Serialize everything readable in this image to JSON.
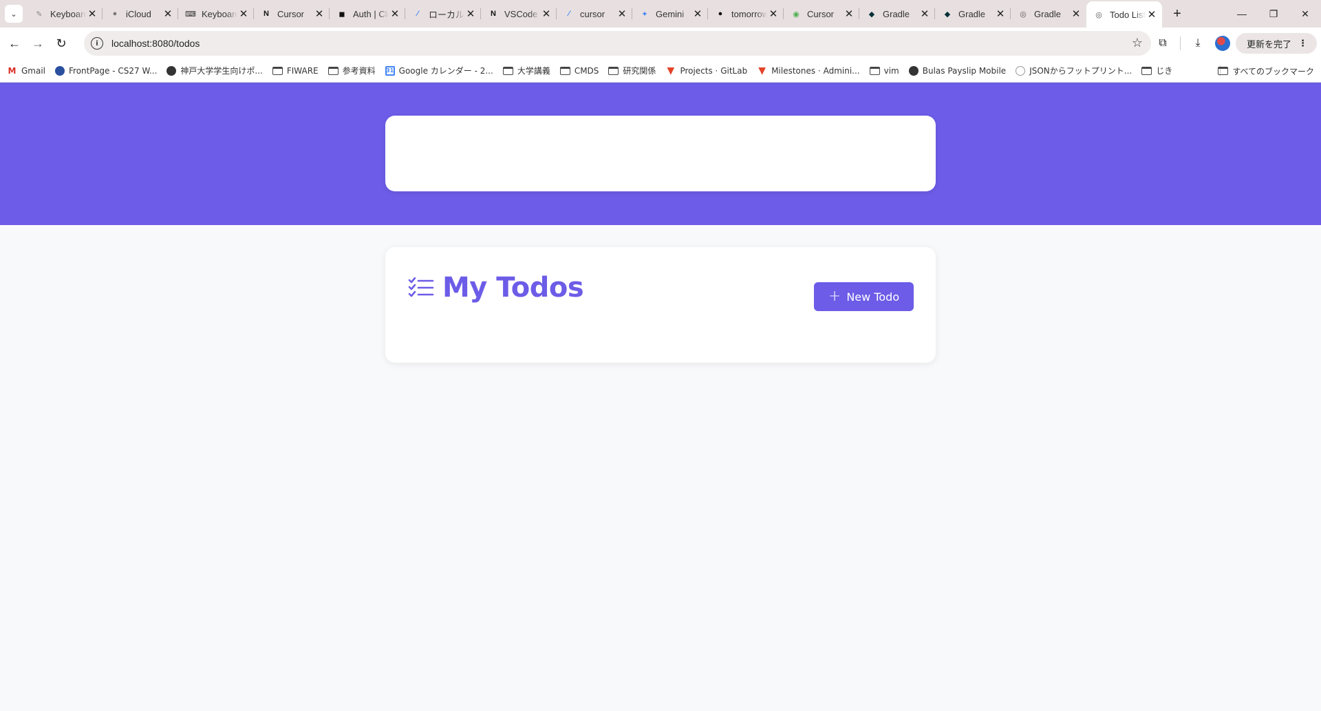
{
  "tabstrip": {
    "search_glyph": "⌄",
    "tabs": [
      {
        "title": "Keyboard",
        "icon": "mac-icon",
        "glyph": "✎",
        "color": "#888888"
      },
      {
        "title": "iCloud",
        "icon": "apple-icon",
        "glyph": "●",
        "color": "#777777"
      },
      {
        "title": "Keyboard",
        "icon": "keyboard-icon",
        "glyph": "⌨",
        "color": "#333333"
      },
      {
        "title": "Cursor",
        "icon": "notion-icon",
        "glyph": "N",
        "color": "#111111"
      },
      {
        "title": "Auth | Clerk",
        "icon": "auth-icon",
        "glyph": "◼",
        "color": "#111111"
      },
      {
        "title": "ローカル",
        "icon": "slash-icon",
        "glyph": "⁄",
        "color": "#3b82f6"
      },
      {
        "title": "VSCode",
        "icon": "notion-icon",
        "glyph": "N",
        "color": "#111111"
      },
      {
        "title": "cursor",
        "icon": "slash-icon",
        "glyph": "⁄",
        "color": "#3b82f6"
      },
      {
        "title": "Gemini",
        "icon": "gemini-icon",
        "glyph": "✦",
        "color": "#4285f4"
      },
      {
        "title": "tomorrow",
        "icon": "github-icon",
        "glyph": "●",
        "color": "#111111"
      },
      {
        "title": "Cursor",
        "icon": "green-circle-icon",
        "glyph": "◉",
        "color": "#4caf50"
      },
      {
        "title": "Gradle",
        "icon": "gradle-icon",
        "glyph": "◆",
        "color": "#02303a"
      },
      {
        "title": "Gradle",
        "icon": "gradle-icon",
        "glyph": "◆",
        "color": "#02303a"
      },
      {
        "title": "Gradle",
        "icon": "globe-icon",
        "glyph": "◎",
        "color": "#555555"
      },
      {
        "title": "Todo List",
        "icon": "globe-icon",
        "glyph": "◎",
        "color": "#555555",
        "active": true
      }
    ],
    "close_glyph": "✕",
    "newtab_glyph": "+",
    "window_controls": {
      "minimize": "—",
      "restore": "❐",
      "close": "✕"
    }
  },
  "toolbar": {
    "back": "←",
    "forward": "→",
    "reload": "↻",
    "url": "localhost:8080/todos",
    "info_glyph": "i",
    "star": "☆",
    "extensions": "⧉",
    "download": "⤓",
    "update_label": "更新を完了",
    "menu_dots": "⋮"
  },
  "bookmarks": {
    "items": [
      {
        "label": "Gmail",
        "icon": "gmail-icon",
        "kind": "gmail",
        "glyph": "M"
      },
      {
        "label": "FrontPage - CS27 W...",
        "icon": "frontpage-icon",
        "kind": "fp",
        "glyph": ""
      },
      {
        "label": "神戸大学学生向けポ...",
        "icon": "globe-icon",
        "kind": "globe",
        "glyph": ""
      },
      {
        "label": "FIWARE",
        "icon": "folder-icon",
        "kind": "folder",
        "glyph": ""
      },
      {
        "label": "参考資料",
        "icon": "folder-icon",
        "kind": "folder",
        "glyph": ""
      },
      {
        "label": "Google カレンダー - 2...",
        "icon": "google-calendar-icon",
        "kind": "gcal",
        "glyph": "31"
      },
      {
        "label": "大学講義",
        "icon": "folder-icon",
        "kind": "folder",
        "glyph": ""
      },
      {
        "label": "CMDS",
        "icon": "folder-icon",
        "kind": "folder",
        "glyph": ""
      },
      {
        "label": "研究関係",
        "icon": "folder-icon",
        "kind": "folder",
        "glyph": ""
      },
      {
        "label": "Projects · GitLab",
        "icon": "gitlab-icon",
        "kind": "gitlab",
        "glyph": "▼"
      },
      {
        "label": "Milestones · Admini...",
        "icon": "gitlab-icon",
        "kind": "gitlab",
        "glyph": "▼"
      },
      {
        "label": "vim",
        "icon": "folder-icon",
        "kind": "folder",
        "glyph": ""
      },
      {
        "label": "Bulas Payslip Mobile",
        "icon": "globe-icon",
        "kind": "globe",
        "glyph": ""
      },
      {
        "label": "JSONからフットプリント...",
        "icon": "json-icon",
        "kind": "json",
        "glyph": ""
      },
      {
        "label": "じき",
        "icon": "folder-icon",
        "kind": "folder",
        "glyph": ""
      }
    ],
    "all_bookmarks": "すべてのブックマーク"
  },
  "page": {
    "title": "My Todos",
    "new_todo_plus": "+",
    "new_todo_label": "New Todo",
    "accent": "#6c5ce7"
  }
}
